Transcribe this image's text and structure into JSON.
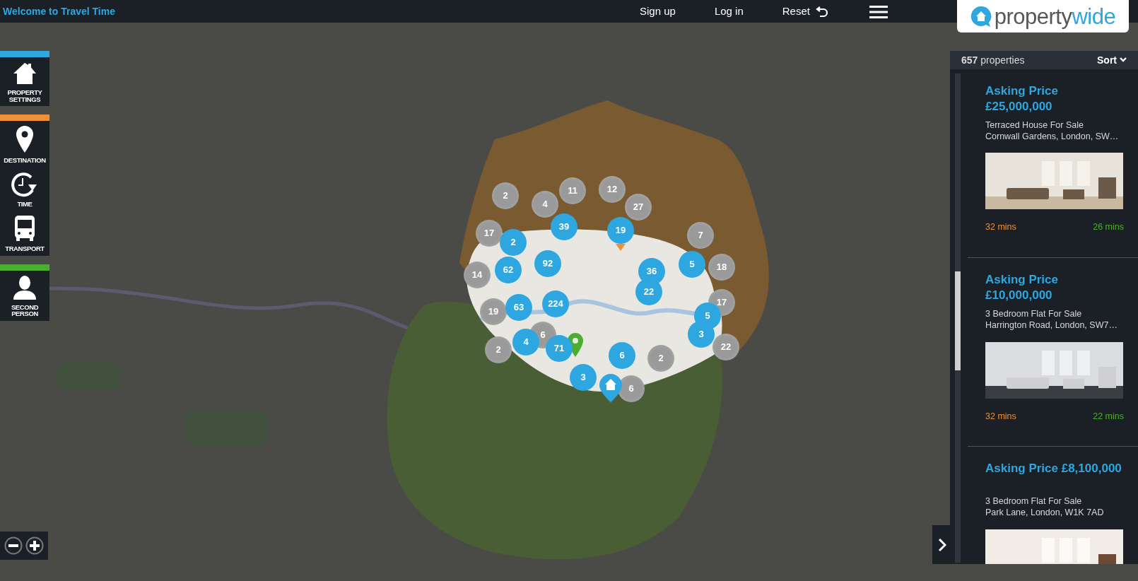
{
  "topbar": {
    "title": "Welcome to Travel Time",
    "links": [
      "Sign up",
      "Log in",
      "Reset"
    ]
  },
  "logo": {
    "parts": [
      "property",
      "wide"
    ]
  },
  "sidebar": {
    "sections": [
      {
        "color": "#2ea7e0",
        "items": [
          "PROPERTY SETTINGS"
        ]
      },
      {
        "color": "#f0913a",
        "items": [
          "DESTINATION",
          "TIME",
          "TRANSPORT"
        ]
      },
      {
        "color": "#4cae2f",
        "items": [
          "SECOND PERSON"
        ]
      }
    ]
  },
  "map": {
    "clusters": [
      {
        "count": "2",
        "kind": "grey"
      },
      {
        "count": "4",
        "kind": "grey"
      },
      {
        "count": "11",
        "kind": "grey"
      },
      {
        "count": "12",
        "kind": "grey"
      },
      {
        "count": "27",
        "kind": "grey"
      },
      {
        "count": "17",
        "kind": "grey"
      },
      {
        "count": "7",
        "kind": "grey"
      },
      {
        "count": "18",
        "kind": "grey"
      },
      {
        "count": "14",
        "kind": "grey"
      },
      {
        "count": "19",
        "kind": "grey"
      },
      {
        "count": "17",
        "kind": "grey"
      },
      {
        "count": "22",
        "kind": "grey"
      },
      {
        "count": "2",
        "kind": "grey"
      },
      {
        "count": "6",
        "kind": "grey"
      },
      {
        "count": "2",
        "kind": "grey"
      },
      {
        "count": "6",
        "kind": "grey"
      },
      {
        "count": "39",
        "kind": "blue"
      },
      {
        "count": "19",
        "kind": "blue"
      },
      {
        "count": "2",
        "kind": "blue"
      },
      {
        "count": "92",
        "kind": "blue"
      },
      {
        "count": "62",
        "kind": "blue"
      },
      {
        "count": "5",
        "kind": "blue"
      },
      {
        "count": "36",
        "kind": "blue"
      },
      {
        "count": "22",
        "kind": "blue"
      },
      {
        "count": "224",
        "kind": "blue"
      },
      {
        "count": "63",
        "kind": "blue"
      },
      {
        "count": "5",
        "kind": "blue"
      },
      {
        "count": "3",
        "kind": "blue"
      },
      {
        "count": "4",
        "kind": "blue"
      },
      {
        "count": "71",
        "kind": "blue"
      },
      {
        "count": "6",
        "kind": "blue"
      },
      {
        "count": "3",
        "kind": "blue"
      }
    ]
  },
  "results": {
    "count": "657",
    "count_label": "properties",
    "sort": "Sort",
    "listings": [
      {
        "heading": "Asking Price £25,000,000",
        "type": "Terraced House For Sale",
        "address": "Cornwall Gardens, London, SW…",
        "time_a": "32 mins",
        "time_b": "26 mins"
      },
      {
        "heading": "Asking Price £10,000,000",
        "type": "3 Bedroom Flat For Sale",
        "address": "Harrington Road, London, SW7…",
        "time_a": "32 mins",
        "time_b": "22 mins"
      },
      {
        "heading": "Asking Price £8,100,000",
        "type": "3 Bedroom Flat For Sale",
        "address": "Park Lane, London, W1K 7AD"
      }
    ]
  }
}
